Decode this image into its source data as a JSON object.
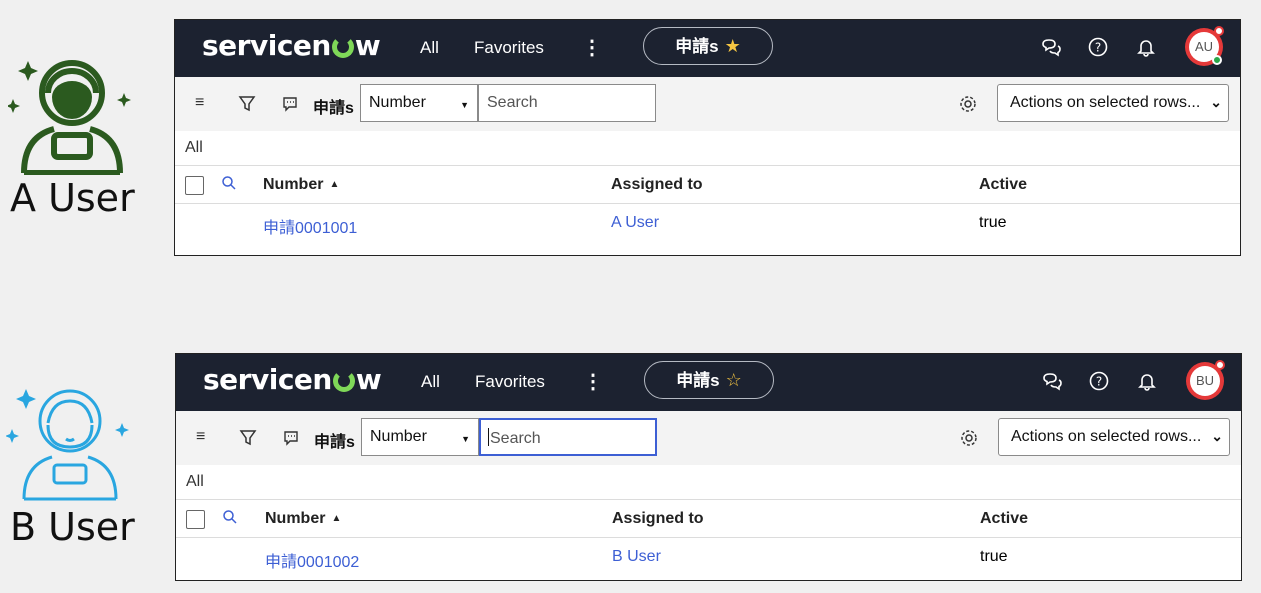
{
  "colors": {
    "topbar_bg": "#1c2230",
    "link": "#3d5fd4",
    "a_user_icon": "#2b5a1f",
    "b_user_icon": "#29a6e0",
    "avatar_ring": "#e53939"
  },
  "users": [
    {
      "name": "A User",
      "icon": "astronaut-icon",
      "panel": {
        "logo": "servicenow",
        "nav_all": "All",
        "nav_favorites": "Favorites",
        "nav_more": "⋮",
        "pill_label": "申請s",
        "pill_star": "★",
        "avatar": "AU",
        "toolbar_label": "申請s",
        "field_select": "Number",
        "search_placeholder": "Search",
        "actions": "Actions on selected rows...",
        "breadcrumb": "All",
        "columns": [
          "Number",
          "Assigned to",
          "Active"
        ],
        "rows": [
          {
            "number": "申請0001001",
            "assigned_to": "A User",
            "active": "true"
          }
        ]
      }
    },
    {
      "name": "B User",
      "icon": "astronaut-icon",
      "panel": {
        "logo": "servicenow",
        "nav_all": "All",
        "nav_favorites": "Favorites",
        "nav_more": "⋮",
        "pill_label": "申請s",
        "pill_star": "☆",
        "avatar": "BU",
        "toolbar_label": "申請s",
        "field_select": "Number",
        "search_placeholder": "Search",
        "actions": "Actions on selected rows...",
        "breadcrumb": "All",
        "columns": [
          "Number",
          "Assigned to",
          "Active"
        ],
        "rows": [
          {
            "number": "申請0001002",
            "assigned_to": "B User",
            "active": "true"
          }
        ]
      }
    }
  ]
}
